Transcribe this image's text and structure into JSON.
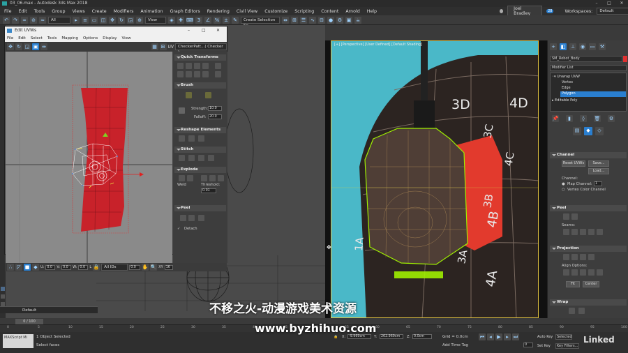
{
  "window": {
    "title": "03_06.max - Autodesk 3ds Max 2018",
    "user": "Joel Bradley",
    "badge": "28",
    "workspace_label": "Workspaces:",
    "workspace": "Default"
  },
  "menu": [
    "File",
    "Edit",
    "Tools",
    "Group",
    "Views",
    "Create",
    "Modifiers",
    "Animation",
    "Graph Editors",
    "Rendering",
    "Civil View",
    "Customize",
    "Scripting",
    "Content",
    "Arnold",
    "Help"
  ],
  "toolbar": {
    "filter": "All",
    "view": "View",
    "selection_set": "Create Selection Se"
  },
  "viewport": {
    "label": "[+] [Perspective] [User Defined] [Default Shading]"
  },
  "grid_labels": [
    {
      "text": "3D"
    },
    {
      "text": "4D"
    },
    {
      "text": "3C"
    },
    {
      "text": "4C"
    },
    {
      "text": "3B"
    },
    {
      "text": "4B"
    },
    {
      "text": "1A"
    },
    {
      "text": "3A"
    },
    {
      "text": "4A"
    }
  ],
  "uvw": {
    "title": "Edit UVWs",
    "menu": [
      "File",
      "Edit",
      "Select",
      "Tools",
      "Mapping",
      "Options",
      "Display",
      "View"
    ],
    "uv_label": "UV",
    "texture": "CheckerPatt...( Checker )",
    "sections": {
      "quick": "Quick Transforms",
      "brush": "Brush",
      "reshape": "Reshape Elements",
      "stitch": "Stitch",
      "explode": "Explode",
      "peel": "Peel"
    },
    "strength_label": "Strength:",
    "strength": "10.0",
    "falloff_label": "Falloff:",
    "falloff": "20.0",
    "weld_label": "Weld",
    "threshold_label": "Threshold:",
    "threshold": "0.01",
    "detach_label": "Detach",
    "status": {
      "u": "U:",
      "u_val": "0.0",
      "v": "V:",
      "v_val": "0.0",
      "w": "W:",
      "w_val": "0.0",
      "l": "L",
      "ids": "All IDs",
      "zoom": "0.0",
      "xy": "XY",
      "grid": "16"
    }
  },
  "modifier": {
    "object": "SM_Robot_Body",
    "list_label": "Modifier List",
    "stack": [
      {
        "name": "Unwrap UVW",
        "level": 0,
        "selected": false
      },
      {
        "name": "Vertex",
        "level": 1,
        "selected": false
      },
      {
        "name": "Edge",
        "level": 1,
        "selected": false
      },
      {
        "name": "Polygon",
        "level": 1,
        "selected": true
      },
      {
        "name": "Editable Poly",
        "level": 0,
        "selected": false
      }
    ]
  },
  "cmd_panel": {
    "channel": "Channel",
    "reset": "Reset UVWs",
    "save": "Save...",
    "load": "Load...",
    "channel_label": "Channel:",
    "map_channel": "Map Channel:",
    "map_channel_val": "1",
    "vertex_color": "Vertex Color Channel",
    "peel": "Peel",
    "seams": "Seams:",
    "projection": "Projection",
    "align": "Align Options:",
    "fit": "Fit",
    "center": "Center",
    "wrap": "Wrap"
  },
  "timeline": {
    "frame": "0 / 100",
    "selected": "1 Object Selected",
    "prompt": "Select faces",
    "default_label": "Default",
    "script_label": "MAXScript Mi",
    "x_label": "X:",
    "x_val": "-9.969cm",
    "y_label": "Y:",
    "y_val": "262.969cm",
    "z_label": "Z:",
    "z_val": "0.0cm",
    "grid": "Grid = 0.0cm",
    "add_time_tag": "Add Time Tag",
    "auto_key": "Auto Key",
    "selected_label": "Selected",
    "set_key": "Set Key",
    "key_filters": "Key Filters...",
    "frame_input": "0"
  },
  "ticks": [
    "0",
    "5",
    "10",
    "15",
    "20",
    "25",
    "30",
    "35",
    "40",
    "45",
    "50",
    "55",
    "60",
    "65",
    "70",
    "75",
    "80",
    "85",
    "90",
    "95",
    "100"
  ],
  "watermark": {
    "cn": "不移之火-动漫游戏美术资源",
    "url": "www.byzhihuo.com",
    "brand": "Linked"
  },
  "colors": {
    "accent": "#2a7fd0",
    "uv_shell": "#c8222a",
    "bg_cyan": "#4ab8c8",
    "edge_green": "#9ff000"
  }
}
